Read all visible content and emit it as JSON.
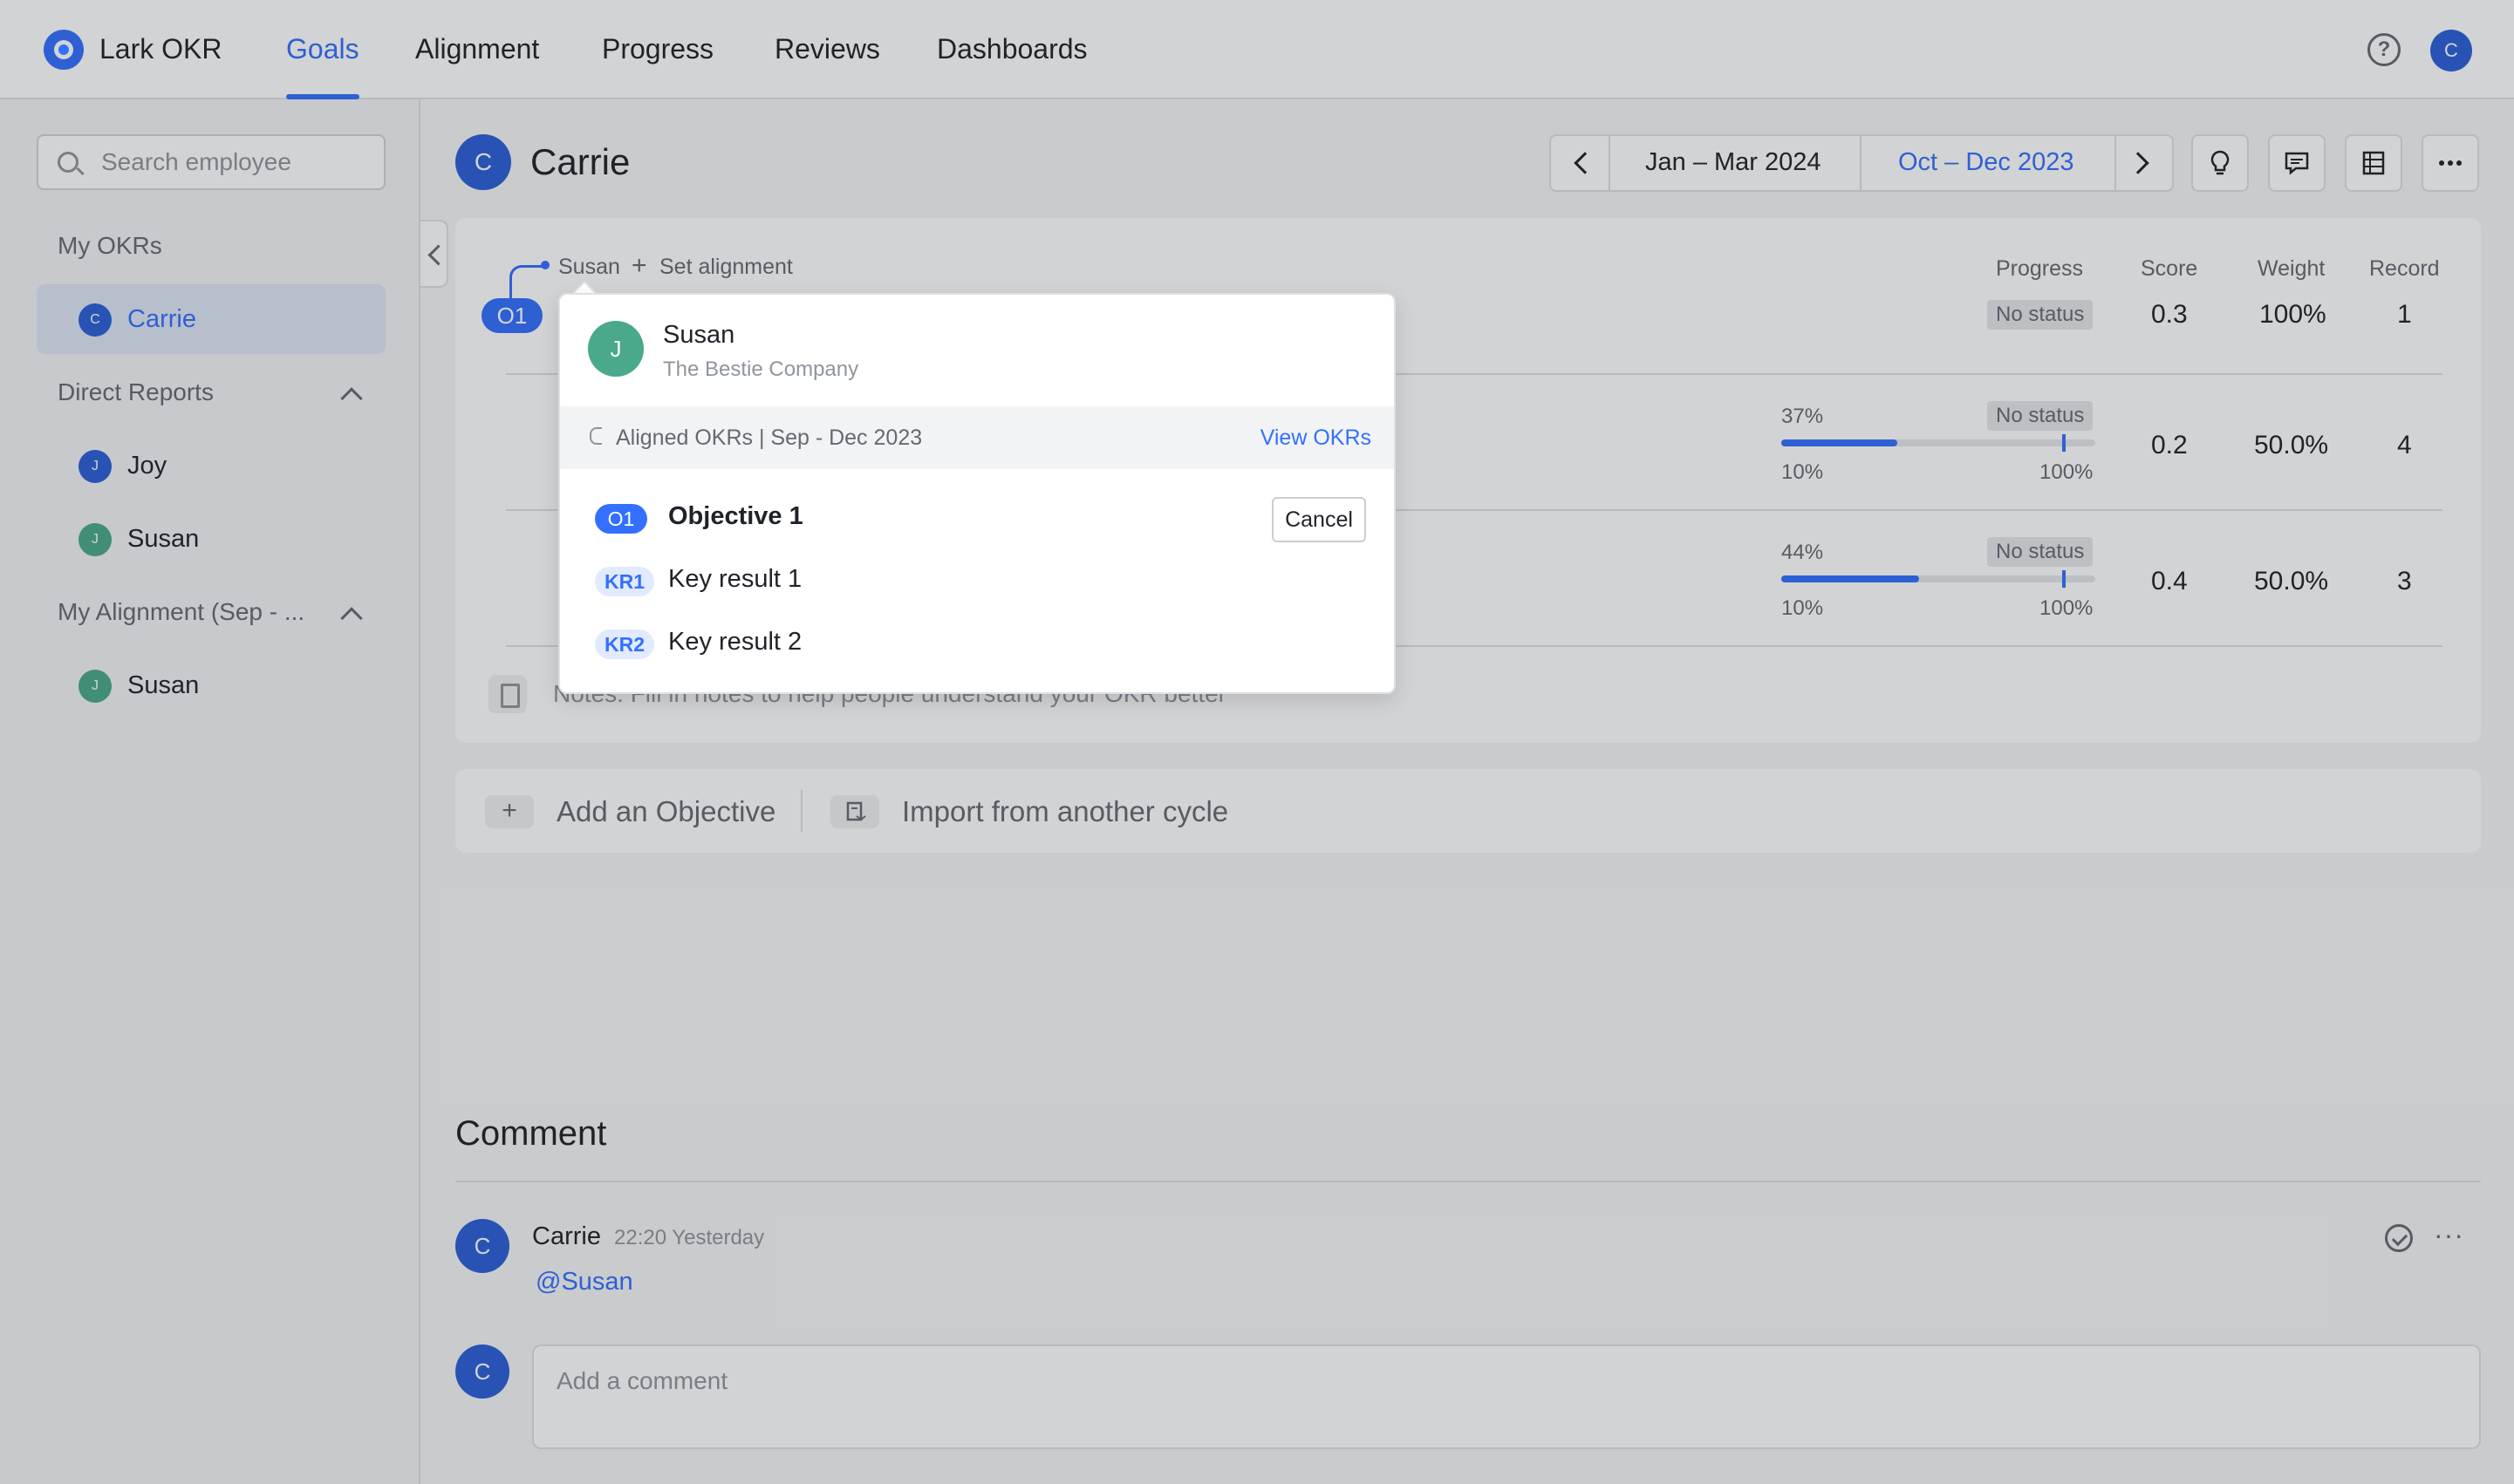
{
  "app": {
    "name": "Lark OKR"
  },
  "nav": {
    "tabs": [
      {
        "label": "Goals",
        "active": true
      },
      {
        "label": "Alignment",
        "active": false
      },
      {
        "label": "Progress",
        "active": false
      },
      {
        "label": "Reviews",
        "active": false
      },
      {
        "label": "Dashboards",
        "active": false
      }
    ],
    "help_icon": "?",
    "avatar_initial": "C"
  },
  "sidebar": {
    "search_placeholder": "Search employee",
    "my_okrs_title": "My OKRs",
    "my_okrs_item": {
      "label": "Carrie",
      "initial": "C"
    },
    "direct_reports_title": "Direct Reports",
    "direct_reports": [
      {
        "label": "Joy",
        "initial": "J"
      },
      {
        "label": "Susan",
        "initial": "J"
      }
    ],
    "my_alignment_title": "My Alignment (Sep - ...",
    "my_alignment": [
      {
        "label": "Susan",
        "initial": "J"
      }
    ]
  },
  "header": {
    "initial": "C",
    "name": "Carrie",
    "period_current": "Jan – Mar 2024",
    "period_selected": "Oct – Dec 2023"
  },
  "okr": {
    "aligned_to": "Susan",
    "set_alignment": "Set alignment",
    "objective_badge": "O1",
    "columns": {
      "progress": "Progress",
      "score": "Score",
      "weight": "Weight",
      "record": "Record"
    },
    "rows": [
      {
        "status": "No status",
        "score": "0.3",
        "weight": "100%",
        "record": "1"
      },
      {
        "percent": "37%",
        "progress": 0.37,
        "status": "No status",
        "min": "10%",
        "max": "100%",
        "score": "0.2",
        "weight": "50.0%",
        "record": "4"
      },
      {
        "percent": "44%",
        "progress": 0.44,
        "status": "No status",
        "min": "10%",
        "max": "100%",
        "score": "0.4",
        "weight": "50.0%",
        "record": "3"
      }
    ],
    "notes_placeholder": "Notes:  Fill in notes to help people understand your OKR better"
  },
  "add_bar": {
    "add_objective": "Add an Objective",
    "import_label": "Import from another cycle"
  },
  "popover": {
    "initial": "J",
    "name": "Susan",
    "company": "The Bestie Company",
    "aligned_okrs": "Aligned OKRs | Sep - Dec 2023",
    "view_okrs": "View OKRs",
    "items": [
      {
        "badge": "O1",
        "label": "Objective 1"
      },
      {
        "badge": "KR1",
        "label": "Key result 1"
      },
      {
        "badge": "KR2",
        "label": "Key result 2"
      }
    ],
    "cancel": "Cancel"
  },
  "comments": {
    "title": "Comment",
    "entries": [
      {
        "initial": "C",
        "author": "Carrie",
        "time": "22:20 Yesterday",
        "text": "@Susan"
      }
    ],
    "input_initial": "C",
    "input_placeholder": "Add a comment"
  },
  "colors": {
    "accent": "#3370ff",
    "avatar_blue": "#2b5fd9",
    "avatar_green": "#4aa88c"
  },
  "icons": [
    "logo-icon",
    "help-icon",
    "search-icon",
    "chevron-up-icon",
    "chevron-left-icon",
    "chevron-right-icon",
    "lightbulb-icon",
    "chat-icon",
    "table-icon",
    "more-icon",
    "plus-icon",
    "import-icon",
    "note-icon",
    "check-circle-icon",
    "align-icon"
  ]
}
